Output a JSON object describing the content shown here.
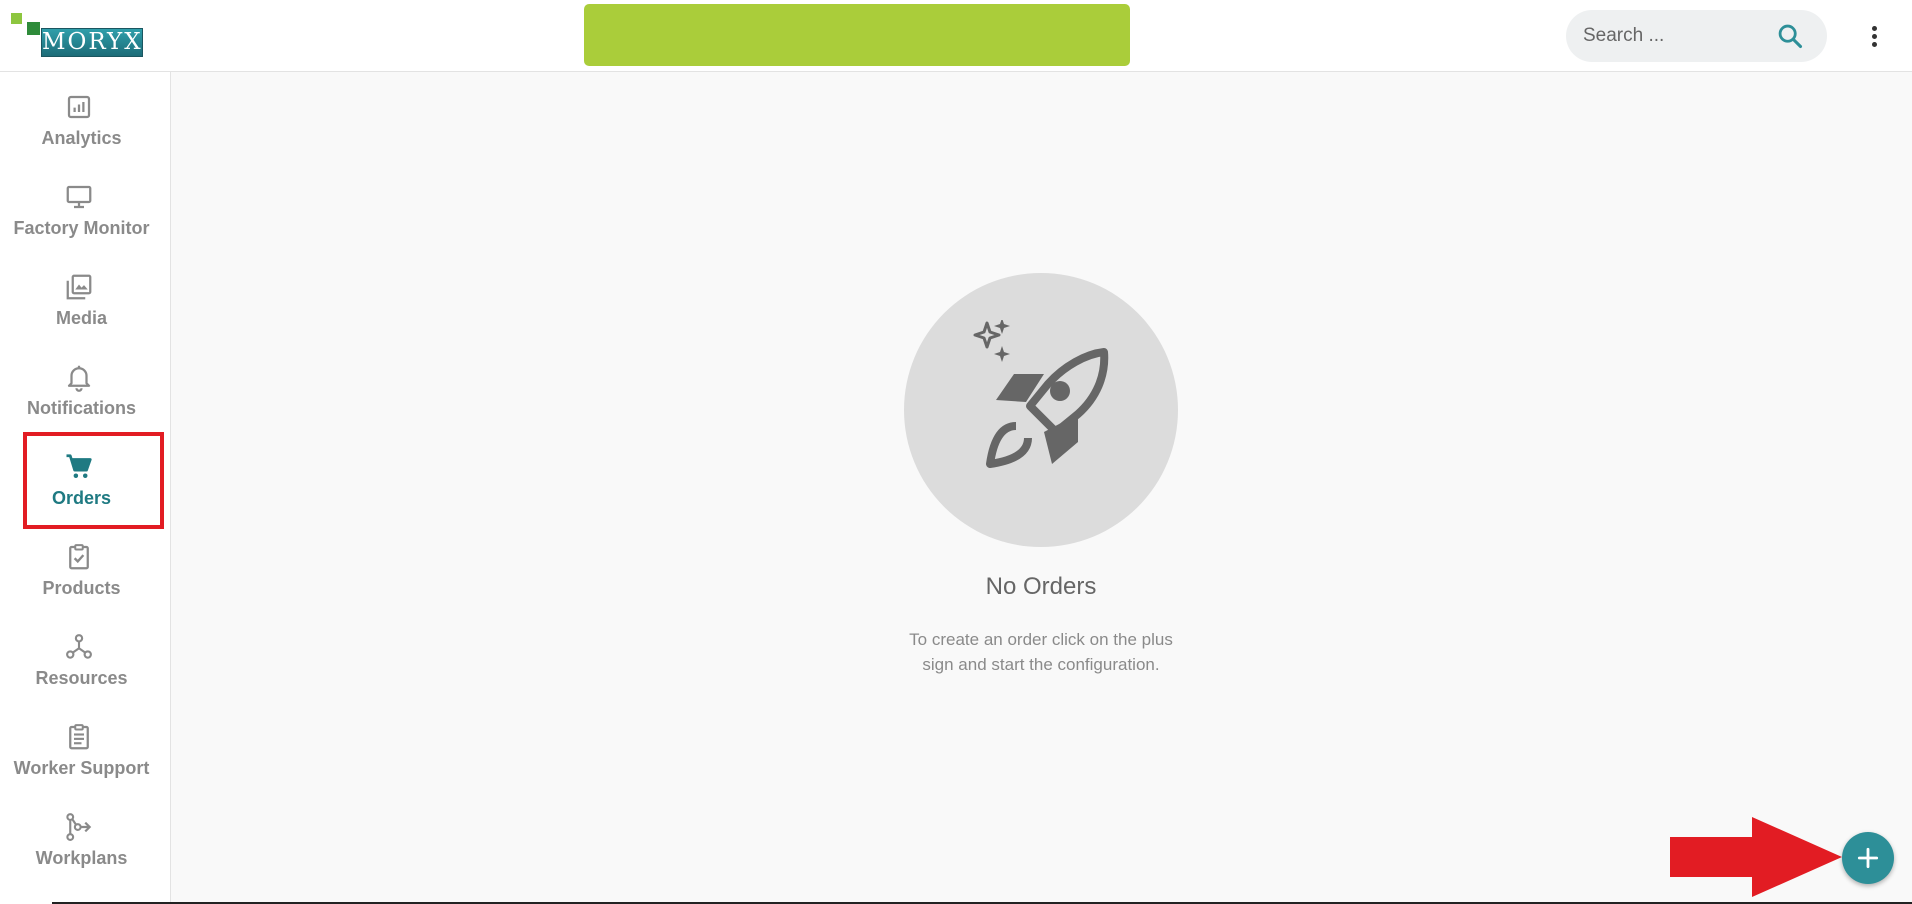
{
  "header": {
    "logo_text": "MORYX",
    "search": {
      "placeholder": "Search ..."
    }
  },
  "sidebar": {
    "items": [
      {
        "label": "Analytics",
        "icon": "analytics-icon"
      },
      {
        "label": "Factory Monitor",
        "icon": "monitor-icon"
      },
      {
        "label": "Media",
        "icon": "media-icon"
      },
      {
        "label": "Notifications",
        "icon": "bell-icon"
      },
      {
        "label": "Orders",
        "icon": "cart-icon",
        "active": true
      },
      {
        "label": "Products",
        "icon": "clipboard-check-icon"
      },
      {
        "label": "Resources",
        "icon": "resources-icon"
      },
      {
        "label": "Worker Support",
        "icon": "document-icon"
      },
      {
        "label": "Workplans",
        "icon": "workplans-icon"
      }
    ]
  },
  "main": {
    "empty_state": {
      "title": "No Orders",
      "description": "To create an order click on the plus sign and start the configuration.",
      "icon": "rocket-icon"
    }
  },
  "fab": {
    "icon": "plus-icon"
  },
  "colors": {
    "accent": "#1f7a82",
    "banner": "#aacd3a",
    "fab": "#2d8f98",
    "highlight": "#e21c23"
  }
}
